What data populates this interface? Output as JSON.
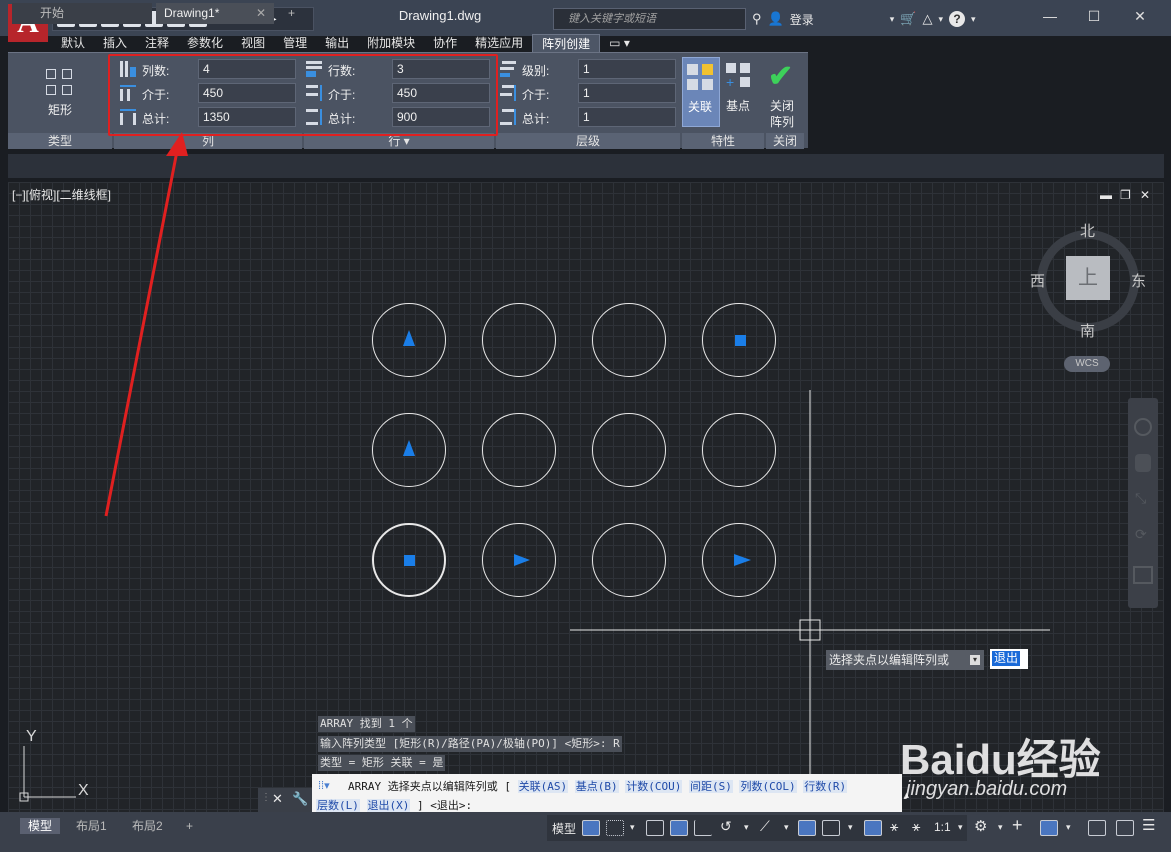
{
  "title_bar": {
    "app_logo": "A",
    "document_title": "Drawing1.dwg",
    "search_placeholder": "键入关键字或短语",
    "login_label": "登录",
    "help_label": "?",
    "window_controls": {
      "minimize": "—",
      "maximize": "☐",
      "close": "✕"
    }
  },
  "ribbon_tabs": [
    "默认",
    "插入",
    "注释",
    "参数化",
    "视图",
    "管理",
    "输出",
    "附加模块",
    "协作",
    "精选应用",
    "阵列创建"
  ],
  "active_ribbon_tab": "阵列创建",
  "ribbon": {
    "type_panel": {
      "button_label": "矩形",
      "panel_label": "类型"
    },
    "columns_panel": {
      "panel_label": "列",
      "count_label": "列数:",
      "count_value": "4",
      "between_label": "介于:",
      "between_value": "450",
      "total_label": "总计:",
      "total_value": "1350"
    },
    "rows_panel": {
      "panel_label": "行 ▾",
      "count_label": "行数:",
      "count_value": "3",
      "between_label": "介于:",
      "between_value": "450",
      "total_label": "总计:",
      "total_value": "900"
    },
    "levels_panel": {
      "panel_label": "层级",
      "count_label": "级别:",
      "count_value": "1",
      "between_label": "介于:",
      "between_value": "1",
      "total_label": "总计:",
      "total_value": "1"
    },
    "properties_panel": {
      "panel_label": "特性",
      "associative_label": "关联",
      "basepoint_label": "基点"
    },
    "close_panel": {
      "panel_label": "关闭",
      "close_label_line1": "关闭",
      "close_label_line2": "阵列"
    }
  },
  "doc_tabs": {
    "start": "开始",
    "drawing": "Drawing1*",
    "add": "+"
  },
  "viewport": {
    "label": "[−][俯视][二维线框]",
    "viewcube": {
      "north": "北",
      "south": "南",
      "east": "东",
      "west": "西",
      "face": "上",
      "wcs": "WCS"
    },
    "axis_x": "X",
    "axis_y": "Y"
  },
  "command": {
    "history": [
      "ARRAY 找到 1 个",
      "输入阵列类型 [矩形(R)/路径(PA)/极轴(PO)] <矩形>: R",
      "类型 = 矩形  关联 = 是"
    ],
    "prompt_line1": "ARRAY 选择夹点以编辑阵列或 [",
    "options": [
      "关联(AS)",
      "基点(B)",
      "计数(COU)",
      "间距(S)",
      "列数(COL)",
      "行数(R)",
      "层数(L)",
      "退出(X)"
    ],
    "prompt_end": "] <退出>:",
    "tooltip": "选择夹点以编辑阵列或",
    "tooltip_option": "退出"
  },
  "status_bar": {
    "layout_tabs": [
      "模型",
      "布局1",
      "布局2"
    ],
    "add_layout": "+",
    "model_label": "模型",
    "scale": "1:1"
  },
  "watermark": {
    "brand": "Baidu经验",
    "url": "jingyan.baidu.com"
  },
  "colors": {
    "accent_red": "#e02020",
    "marker_blue": "#1a7ee8",
    "ribbon_bg": "#4b5362",
    "canvas_bg": "#212428"
  }
}
